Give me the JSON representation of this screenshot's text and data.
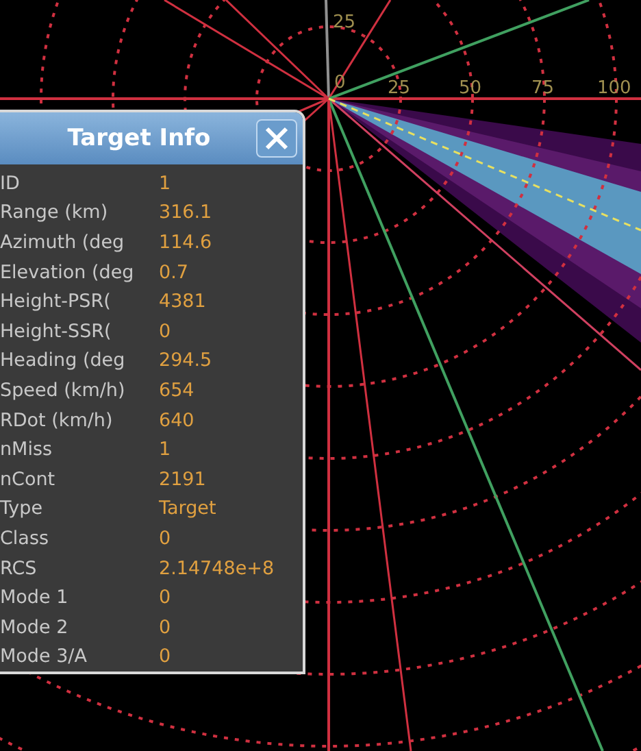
{
  "radar": {
    "range_labels": [
      "25",
      "0",
      "25",
      "50",
      "75",
      "100"
    ]
  },
  "dialog": {
    "title": "Target Info",
    "fields": [
      {
        "label": "ID",
        "value": "1"
      },
      {
        "label": "Range (km)",
        "value": "316.1"
      },
      {
        "label": "Azimuth (deg",
        "value": "114.6"
      },
      {
        "label": "Elevation (deg",
        "value": "0.7"
      },
      {
        "label": "Height-PSR(",
        "value": "4381"
      },
      {
        "label": "Height-SSR(",
        "value": "0"
      },
      {
        "label": "Heading (deg",
        "value": "294.5"
      },
      {
        "label": "Speed (km/h)",
        "value": "654"
      },
      {
        "label": "RDot (km/h)",
        "value": "640"
      },
      {
        "label": "nMiss",
        "value": "1"
      },
      {
        "label": "nCont",
        "value": "2191"
      },
      {
        "label": "Type",
        "value": "Target"
      },
      {
        "label": "Class",
        "value": "0"
      },
      {
        "label": "RCS",
        "value": "2.14748e+8"
      },
      {
        "label": "Mode 1",
        "value": "0"
      },
      {
        "label": "Mode 2",
        "value": "0"
      },
      {
        "label": "Mode 3/A",
        "value": "0"
      }
    ]
  }
}
